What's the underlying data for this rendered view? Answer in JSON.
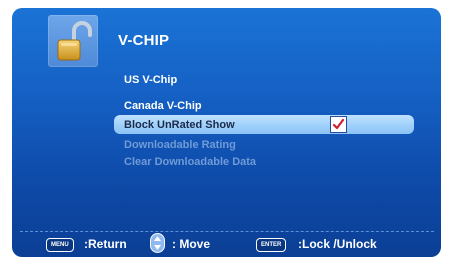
{
  "title": "V-CHIP",
  "icons": {
    "lock": "unlocked-padlock-icon",
    "checkbox": "checkmark-icon",
    "nav": "up-down-arrows-icon"
  },
  "menu": {
    "items": [
      {
        "label": "US V-Chip",
        "state": "enabled"
      },
      {
        "label": "Canada V-Chip",
        "state": "enabled"
      },
      {
        "label": "Block UnRated Show",
        "state": "selected",
        "checked": true
      },
      {
        "label": "Downloadable Rating",
        "state": "disabled"
      },
      {
        "label": "Clear Downloadable Data",
        "state": "disabled"
      }
    ]
  },
  "footer": {
    "menu_key": "MENU",
    "return_label": ":Return",
    "move_label": ": Move",
    "enter_key": "ENTER",
    "lock_label": ":Lock /Unlock"
  },
  "colors": {
    "background_top": "#1b73d6",
    "background_bottom": "#0b3f95",
    "selection": "#9fd0fb",
    "disabled_text": "#6f9bd6",
    "check": "#d01f2f"
  }
}
